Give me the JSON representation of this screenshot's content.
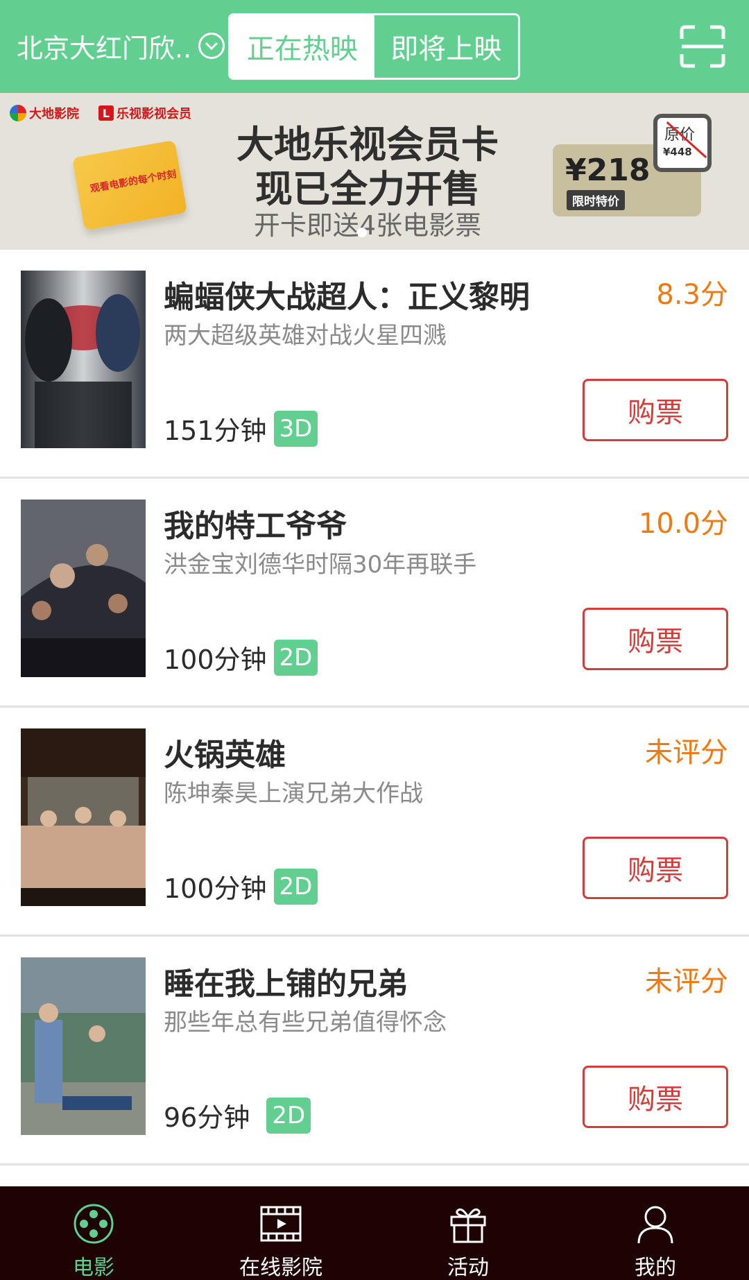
{
  "header": {
    "city": "北京大红门欣..",
    "tabs": [
      {
        "label": "正在热映",
        "active": true
      },
      {
        "label": "即将上映",
        "active": false
      }
    ]
  },
  "banner": {
    "brand1": "大地影院",
    "brand2": "乐视影视会员",
    "card_text": "观看电影的每个时刻",
    "title_line1": "大地乐视会员卡",
    "title_line2": "现已全力开售",
    "subtitle": "开卡即送4张电影票",
    "price": "¥218",
    "price_tag": "限时特价",
    "original_label": "原价",
    "original_price": "¥448"
  },
  "movies": [
    {
      "title": "蝙蝠侠大战超人：正义黎明",
      "score": "8.3分",
      "desc": "两大超级英雄对战火星四溅",
      "duration": "151分钟",
      "format": "3D",
      "buy": "购票"
    },
    {
      "title": "我的特工爷爷",
      "score": "10.0分",
      "desc": "洪金宝刘德华时隔30年再联手",
      "duration": "100分钟",
      "format": "2D",
      "buy": "购票"
    },
    {
      "title": "火锅英雄",
      "score": "未评分",
      "desc": "陈坤秦昊上演兄弟大作战",
      "duration": "100分钟",
      "format": "2D",
      "buy": "购票"
    },
    {
      "title": "睡在我上铺的兄弟",
      "score": "未评分",
      "desc": "那些年总有些兄弟值得怀念",
      "duration": "96分钟",
      "format": "2D",
      "buy": "购票"
    }
  ],
  "nav": [
    {
      "label": "电影",
      "icon": "film-reel-icon",
      "active": true
    },
    {
      "label": "在线影院",
      "icon": "video-play-icon",
      "active": false
    },
    {
      "label": "活动",
      "icon": "gift-icon",
      "active": false
    },
    {
      "label": "我的",
      "icon": "user-icon",
      "active": false
    }
  ],
  "colors": {
    "accent": "#61cf8f",
    "score": "#f07a10",
    "buy": "#d43c3c",
    "nav_bg": "#1d0304"
  }
}
